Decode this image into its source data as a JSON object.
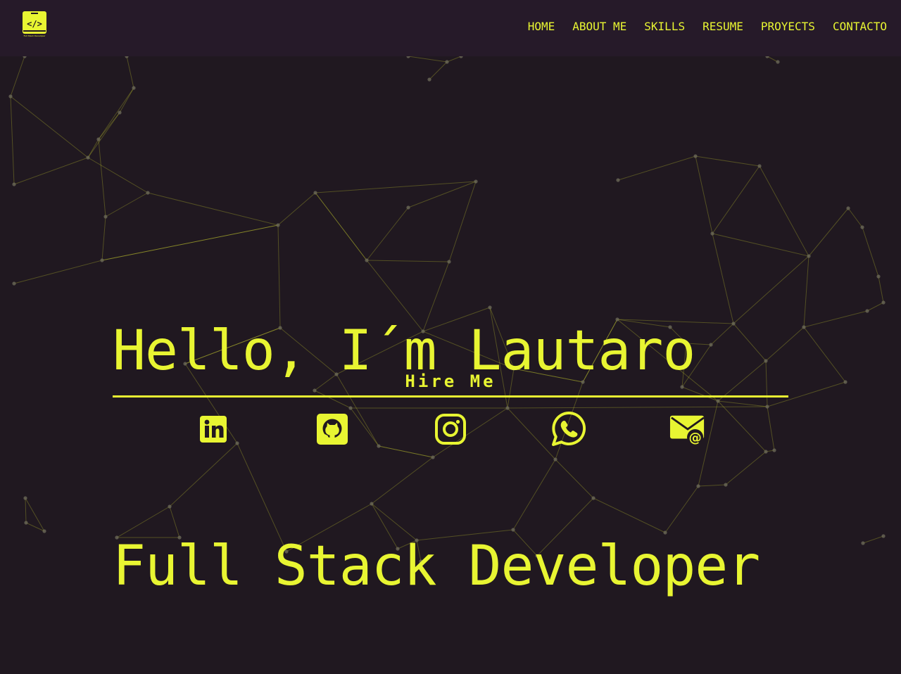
{
  "logo": {
    "icon": "code-brackets-icon",
    "caption": "Full Stack Developer"
  },
  "nav": [
    "HOME",
    "ABOUT ME",
    "SKILLS",
    "RESUME",
    "PROYECTS",
    "CONTACTO"
  ],
  "hero": {
    "line1": "Hello, I´m Lautaro",
    "line2": "Full Stack Developer"
  },
  "hire_me": "Hire Me",
  "social": [
    "linkedin-icon",
    "github-icon",
    "instagram-icon",
    "whatsapp-icon",
    "email-icon"
  ],
  "colors": {
    "accent": "#e8f532",
    "background": "#201820",
    "header": "#261a29"
  }
}
